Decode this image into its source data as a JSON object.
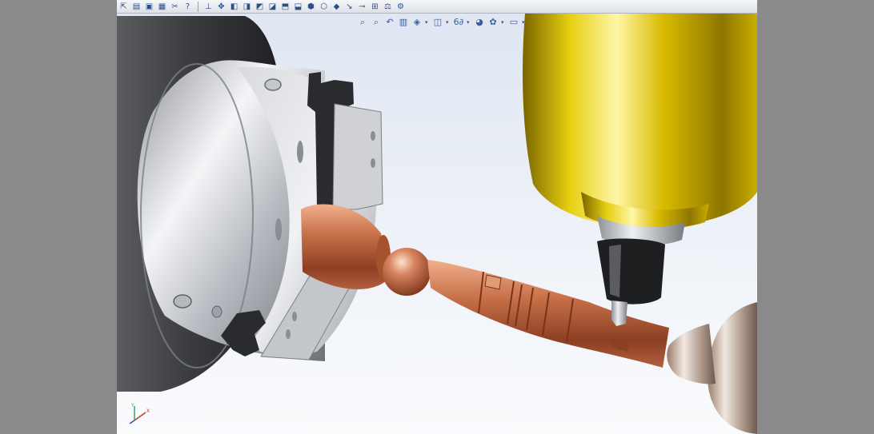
{
  "toolbar": {
    "standard": [
      {
        "name": "select-icon",
        "glyph": "⇱"
      },
      {
        "name": "sketch-icon",
        "glyph": "▤"
      },
      {
        "name": "print-icon",
        "glyph": "▣"
      },
      {
        "name": "document-icon",
        "glyph": "▦"
      },
      {
        "name": "options-icon",
        "glyph": "✂"
      },
      {
        "name": "help-icon",
        "glyph": "?"
      }
    ],
    "views": [
      {
        "name": "view-orientation-icon",
        "glyph": "⊥"
      },
      {
        "name": "move-icon",
        "glyph": "✥"
      },
      {
        "name": "front-view-icon",
        "glyph": "◧"
      },
      {
        "name": "back-view-icon",
        "glyph": "◨"
      },
      {
        "name": "left-view-icon",
        "glyph": "◩"
      },
      {
        "name": "right-view-icon",
        "glyph": "◪"
      },
      {
        "name": "top-view-icon",
        "glyph": "⬒"
      },
      {
        "name": "bottom-view-icon",
        "glyph": "⬓"
      },
      {
        "name": "isometric-view-icon",
        "glyph": "⬢"
      },
      {
        "name": "trimetric-view-icon",
        "glyph": "⬡"
      },
      {
        "name": "dimetric-view-icon",
        "glyph": "◆"
      },
      {
        "name": "normal-to-icon",
        "glyph": "↘"
      },
      {
        "name": "section-tool-icon",
        "glyph": "⊸"
      },
      {
        "name": "measure-icon",
        "glyph": "⊞"
      },
      {
        "name": "mass-properties-icon",
        "glyph": "⚖"
      },
      {
        "name": "settings-gear-icon",
        "glyph": "⚙"
      }
    ]
  },
  "headsup": [
    {
      "name": "zoom-to-fit-icon",
      "glyph": "⌕"
    },
    {
      "name": "zoom-to-area-icon",
      "glyph": "⌕"
    },
    {
      "name": "previous-view-icon",
      "glyph": "↶"
    },
    {
      "name": "section-view-icon",
      "glyph": "▥"
    },
    {
      "name": "view-orientation-dropdown-icon",
      "glyph": "◈",
      "caret": true
    },
    {
      "name": "display-style-icon",
      "glyph": "◫",
      "caret": true
    },
    {
      "name": "hide-show-items-icon",
      "glyph": "6∂",
      "caret": true
    },
    {
      "name": "edit-appearance-icon",
      "glyph": "◕"
    },
    {
      "name": "apply-scene-icon",
      "glyph": "✿",
      "caret": true
    },
    {
      "name": "view-settings-icon",
      "glyph": "▭",
      "caret": true
    }
  ],
  "window_controls": {
    "restore": "–",
    "maximize": "⧉"
  },
  "taskpane": [
    {
      "name": "resources-icon",
      "glyph": "⌂"
    },
    {
      "name": "design-library-icon",
      "glyph": "✎"
    },
    {
      "name": "file-explorer-icon",
      "glyph": "▦"
    },
    {
      "name": "view-palette-icon",
      "glyph": "▤"
    },
    {
      "name": "appearances-icon",
      "glyph": "●"
    },
    {
      "name": "custom-properties-icon",
      "glyph": "▣"
    }
  ],
  "triad": {
    "x_label": "X",
    "y_label": "Y"
  },
  "colors": {
    "copper": "#c8714a",
    "spindle_gold": "#e0c400",
    "chuck_steel": "#c9ccd2",
    "jaw_black": "#222222"
  }
}
